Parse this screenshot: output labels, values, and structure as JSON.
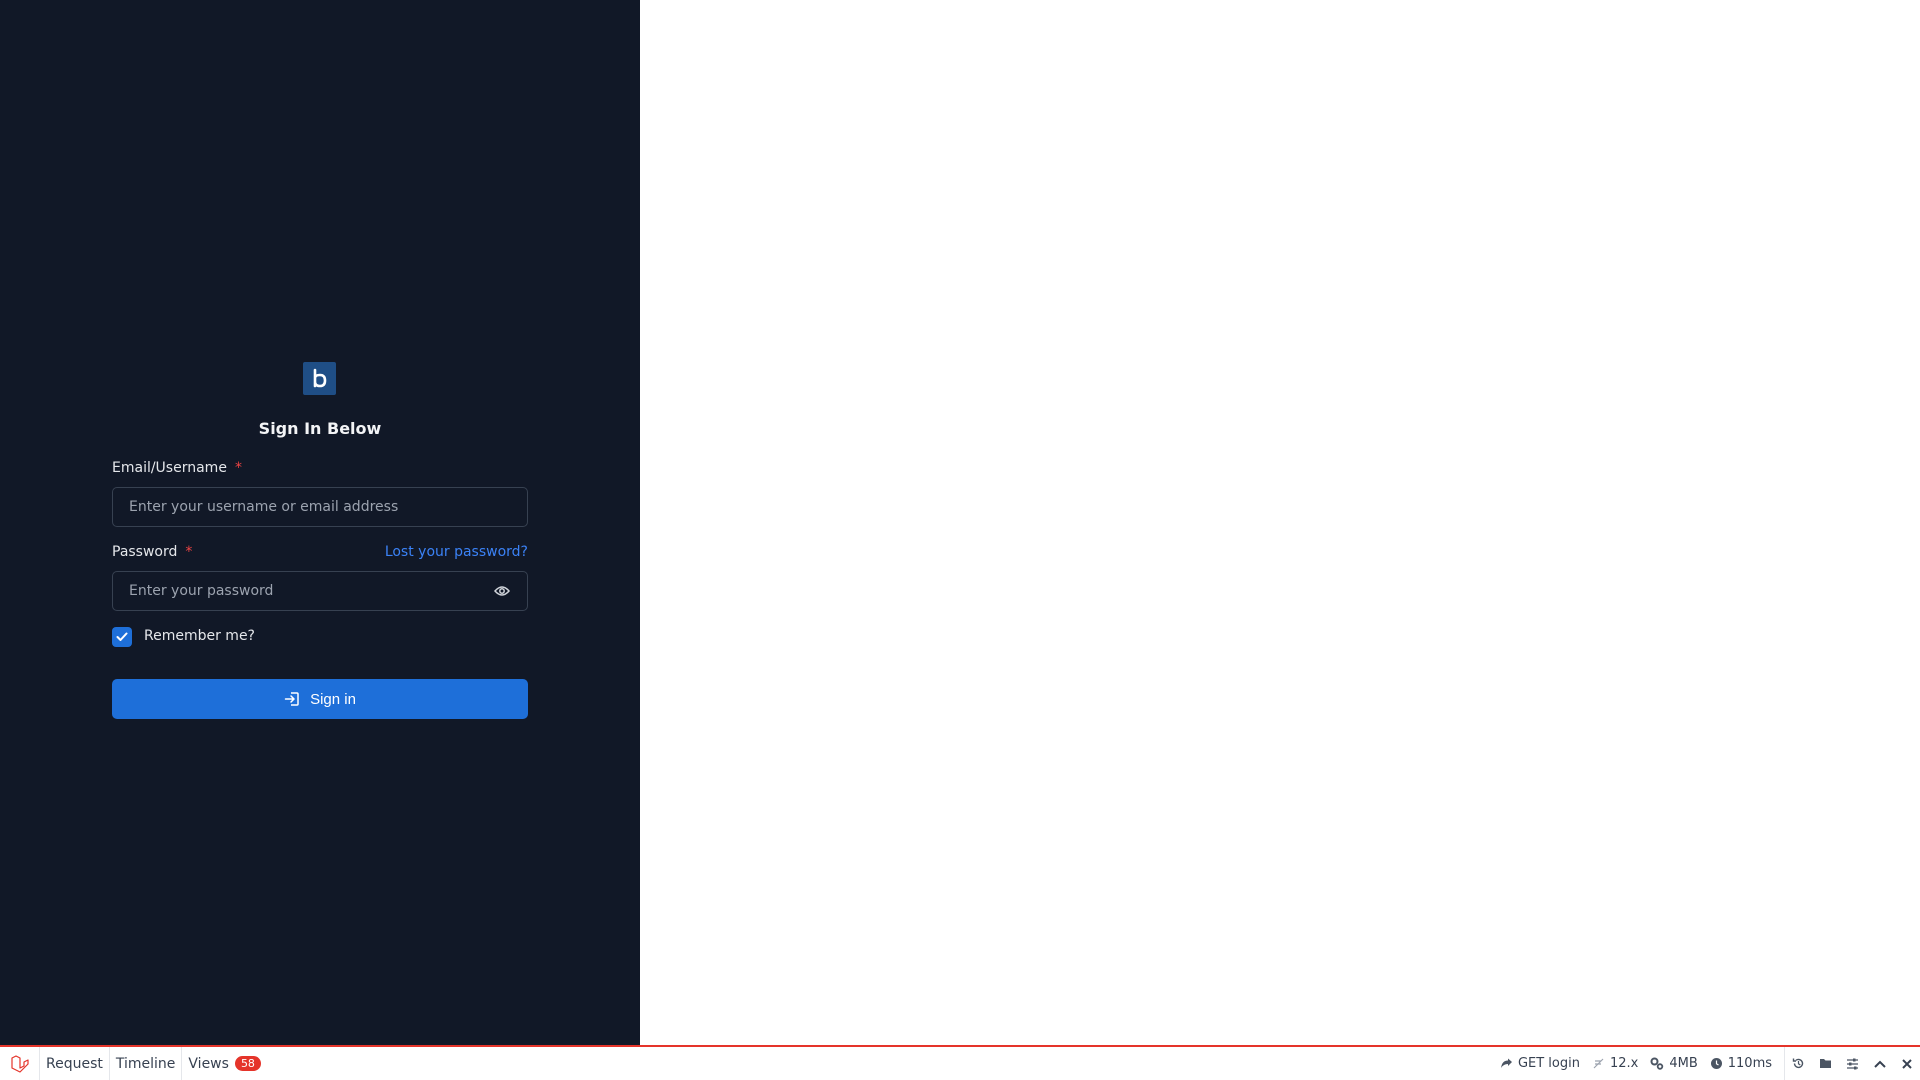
{
  "form": {
    "title": "Sign In Below",
    "email_label": "Email/Username",
    "email_placeholder": "Enter your username or email address",
    "password_label": "Password",
    "password_placeholder": "Enter your password",
    "required_mark": "*",
    "lost_password": "Lost your password?",
    "remember_label": "Remember me?",
    "remember_checked": true,
    "signin_label": "Sign in"
  },
  "debugbar": {
    "tabs": [
      {
        "label": "Request"
      },
      {
        "label": "Timeline"
      },
      {
        "label": "Views",
        "badge": "58"
      }
    ],
    "route": "GET login",
    "version": "12.x",
    "memory": "4MB",
    "time": "110ms"
  },
  "colors": {
    "panel_bg": "#111827",
    "accent": "#1e6fd9",
    "logo_bg": "#1f4e86",
    "required": "#ef4444",
    "debug_red": "#e5342a"
  },
  "icons": [
    "logo-icon",
    "eye-icon",
    "check-icon",
    "sign-in-icon",
    "laravel-icon",
    "share-icon",
    "leaf-icon",
    "cogs-icon",
    "clock-icon",
    "history-icon",
    "folder-icon",
    "sliders-icon",
    "chevron-up-icon",
    "close-icon"
  ]
}
